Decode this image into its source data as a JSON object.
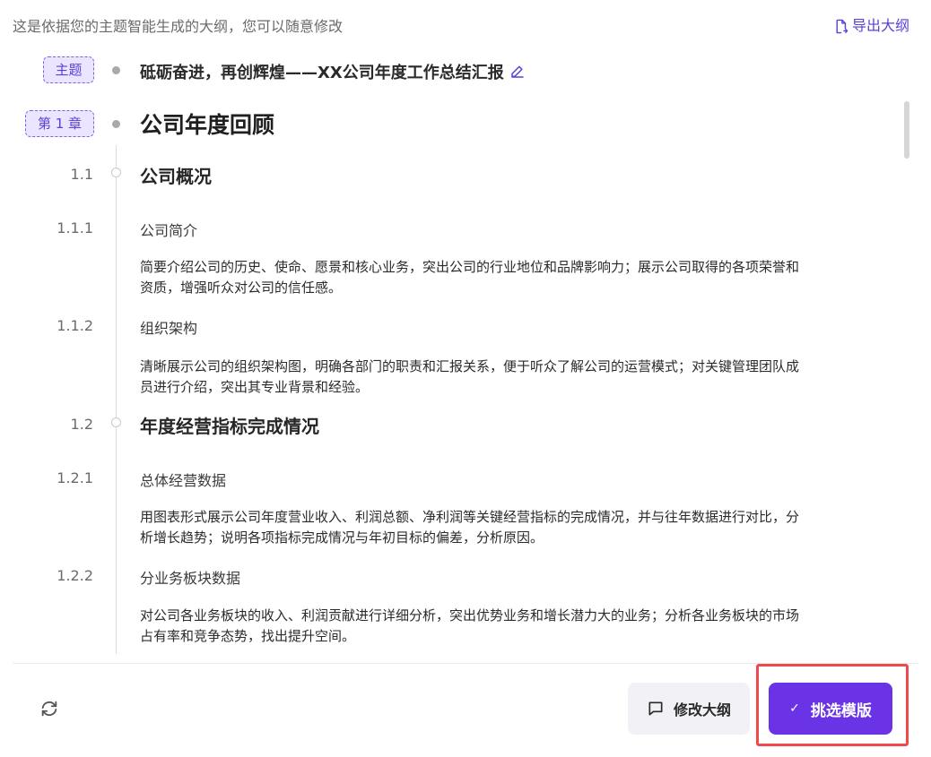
{
  "header": {
    "hint": "这是依据您的主题智能生成的大纲，您可以随意修改",
    "export_label": "导出大纲"
  },
  "outline": {
    "theme": {
      "tag": "主题",
      "title": "砥砺奋进，再创辉煌——XX公司年度工作总结汇报"
    },
    "chapter": {
      "tag": "第 1 章",
      "title": "公司年度回顾"
    },
    "sections": [
      {
        "num": "1.1",
        "title": "公司概况",
        "items": [
          {
            "num": "1.1.1",
            "title": "公司简介",
            "desc": "简要介绍公司的历史、使命、愿景和核心业务，突出公司的行业地位和品牌影响力；展示公司取得的各项荣誉和资质，增强听众对公司的信任感。"
          },
          {
            "num": "1.1.2",
            "title": "组织架构",
            "desc": "清晰展示公司的组织架构图，明确各部门的职责和汇报关系，便于听众了解公司的运营模式；对关键管理团队成员进行介绍，突出其专业背景和经验。"
          }
        ]
      },
      {
        "num": "1.2",
        "title": "年度经营指标完成情况",
        "items": [
          {
            "num": "1.2.1",
            "title": "总体经营数据",
            "desc": "用图表形式展示公司年度营业收入、利润总额、净利润等关键经营指标的完成情况，并与往年数据进行对比，分析增长趋势；说明各项指标完成情况与年初目标的偏差，分析原因。"
          },
          {
            "num": "1.2.2",
            "title": "分业务板块数据",
            "desc": "对公司各业务板块的收入、利润贡献进行详细分析，突出优势业务和增长潜力大的业务；分析各业务板块的市场占有率和竞争态势，找出提升空间。"
          }
        ]
      }
    ]
  },
  "footer": {
    "modify_label": "修改大纲",
    "pick_label": "挑选模版",
    "check_glyph": "✓"
  },
  "colors": {
    "accent": "#6a34e6",
    "tag_bg": "#ece5ff",
    "highlight": "#f0484b"
  }
}
